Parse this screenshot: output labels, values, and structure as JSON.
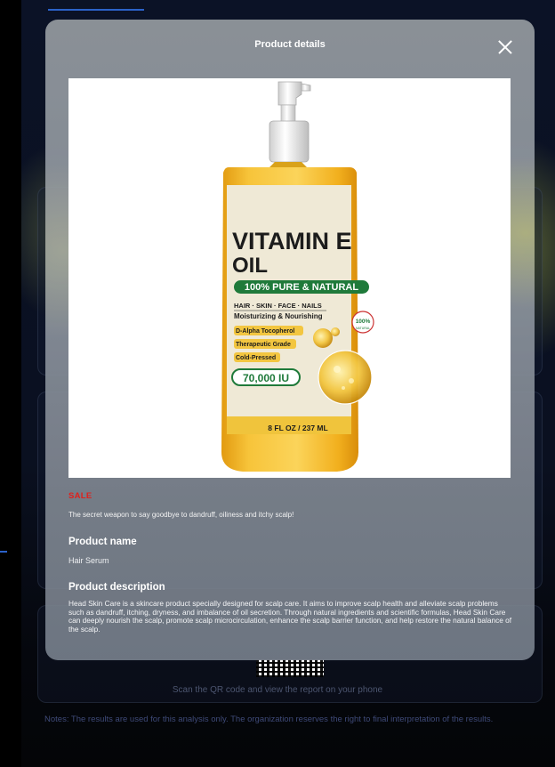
{
  "modal": {
    "title": "Product details",
    "close_icon": "close-icon",
    "sale_tag": "SALE",
    "tagline": "The secret weapon to say goodbye to dandruff, oiliness and itchy scalp!",
    "product_name_heading": "Product name",
    "product_name": "Hair Serum",
    "product_description_heading": "Product description",
    "product_description": "Head Skin Care is a skincare product specially designed for scalp care. It aims to improve scalp health and alleviate scalp problems such as dandruff, itching, dryness, and imbalance of oil secretion. Through natural ingredients and scientific formulas, Head Skin Care can deeply nourish the scalp, promote scalp microcirculation, enhance the scalp barrier function, and help restore the natural balance of the scalp."
  },
  "product_label": {
    "line1": "VITAMIN E",
    "line2": "OIL",
    "badge": "100% PURE & NATURAL",
    "uses": "HAIR · SKIN · FACE · NAILS",
    "benefit": "Moisturizing & Nourishing",
    "feature1": "D-Alpha Tocopherol",
    "feature2": "Therapeutic Grade",
    "feature3": "Cold-Pressed",
    "strength": "70,000 IU",
    "seal": "100%",
    "seal_sub": "NATURAL",
    "volume": "8 FL OZ / 237 ML"
  },
  "background": {
    "scan_text": "Scan the QR code and view the report on your phone",
    "notes": "Notes:  The results are used for this analysis only. The organization reserves the right to final interpretation of the results."
  },
  "colors": {
    "sale": "#e0201c",
    "accent_blue": "#2b62c9",
    "label_green": "#1f7a3a",
    "oil_amber": "#f2b01e"
  }
}
